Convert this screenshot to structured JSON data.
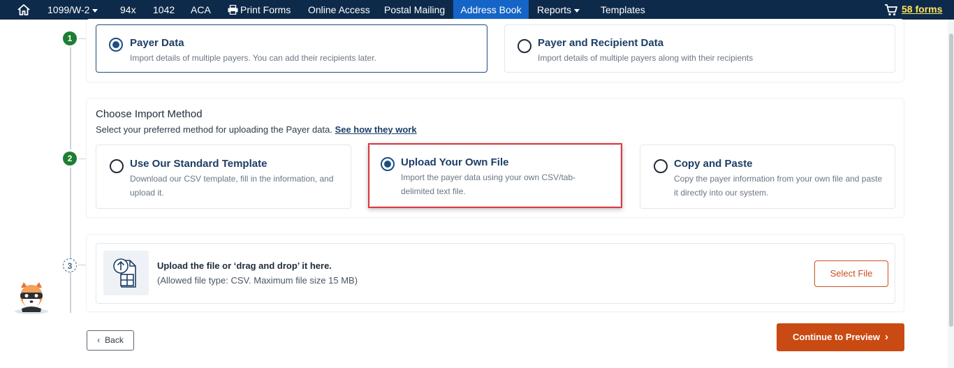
{
  "nav": {
    "items": [
      {
        "label": "1099/W-2",
        "dropdown": true
      },
      {
        "label": "94x"
      },
      {
        "label": "1042"
      },
      {
        "label": "ACA"
      },
      {
        "label": "Print Forms"
      },
      {
        "label": "Online Access"
      },
      {
        "label": "Postal Mailing"
      },
      {
        "label": "Address Book",
        "active": true
      },
      {
        "label": "Reports",
        "dropdown": true
      },
      {
        "label": "Templates"
      }
    ],
    "cart_label": "58 forms"
  },
  "steps": [
    "1",
    "2",
    "3"
  ],
  "import_type": {
    "options": [
      {
        "title": "Payer Data",
        "desc": "Import details of multiple payers. You can add their recipients later.",
        "selected": true
      },
      {
        "title": "Payer and Recipient Data",
        "desc": "Import details of multiple payers along with their recipients",
        "selected": false
      }
    ]
  },
  "import_method": {
    "title": "Choose Import Method",
    "subtitle": "Select your preferred method for uploading the Payer data.",
    "link": "See how they work",
    "options": [
      {
        "title": "Use Our Standard Template",
        "desc": "Download our CSV template, fill in the information, and upload it.",
        "selected": false
      },
      {
        "title": "Upload Your Own File",
        "desc": "Import the payer data using your own CSV/tab-delimited text file.",
        "selected": true
      },
      {
        "title": "Copy and Paste",
        "desc": "Copy the payer information from your own file and paste it directly into our system.",
        "selected": false
      }
    ]
  },
  "upload": {
    "title": "Upload the file or ‘drag and drop’ it here.",
    "note": "(Allowed file type: CSV. Maximum file size 15 MB)",
    "button": "Select File"
  },
  "footer": {
    "back": "Back",
    "continue": "Continue to Preview"
  },
  "colors": {
    "nav_bg": "#0e2a4a",
    "active_tab": "#1565c8",
    "primary": "#c94a12",
    "selected": "#1c4e84",
    "highlight": "#e0393e",
    "step_done": "#1e7d34"
  }
}
